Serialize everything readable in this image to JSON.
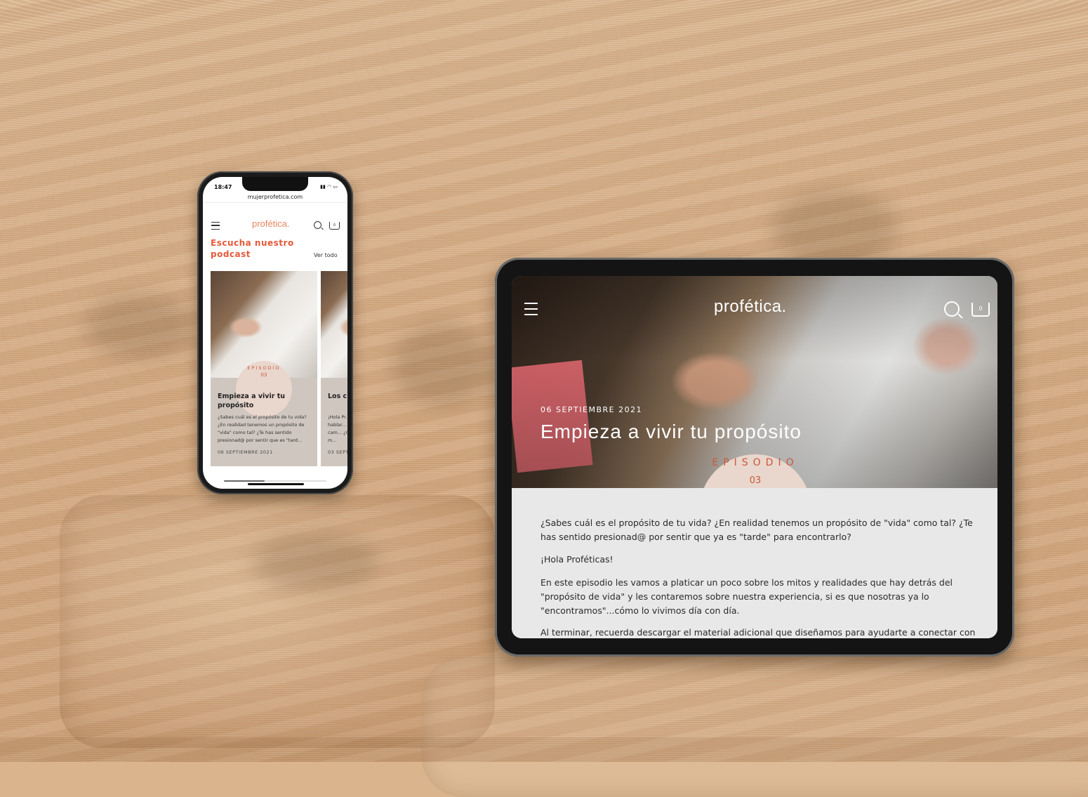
{
  "phone": {
    "status_time": "18:47",
    "url": "mujerprofetica.com",
    "logo": "profética.",
    "cart_count": "0",
    "section_title": "Escucha nuestro podcast",
    "see_all": "Ver todo",
    "cards": [
      {
        "badge_label": "EPISODIO",
        "badge_number": "03",
        "title": "Empieza a vivir tu propósito",
        "excerpt": "¿Sabes cuál es el propósito de tu vida? ¿En realidad tenemos un propósito de \"vida\" como tal? ¿Te has sentido presionad@ por sentir que es \"tard...",
        "date": "06 SEPTIEMBRE 2021"
      },
      {
        "title": "Los c",
        "excerpt": "¡Hola Pr... a hablar... del cam... ¿Qué m...",
        "date": "03 SEPT"
      }
    ]
  },
  "tablet": {
    "logo": "profética.",
    "cart_count": "0",
    "date": "06 SEPTIEMBRE 2021",
    "title": "Empieza a vivir tu propósito",
    "badge_label": "EPISODIO",
    "badge_number": "03",
    "paragraphs": [
      "¿Sabes cuál es el propósito de tu vida? ¿En realidad tenemos un propósito de \"vida\" como tal? ¿Te has sentido presionad@ por sentir que ya es \"tarde\" para encontrarlo?",
      "¡Hola Proféticas!",
      "En este episodio les vamos a platicar un poco sobre los mitos y realidades que hay detrás del \"propósito de vida\" y les contaremos sobre nuestra experiencia, si es que nosotras ya lo \"encontramos\"...cómo lo vivimos día con día.",
      "Al terminar, recuerda descargar el material adicional que diseñamos para ayudarte a conectar con tu"
    ]
  }
}
